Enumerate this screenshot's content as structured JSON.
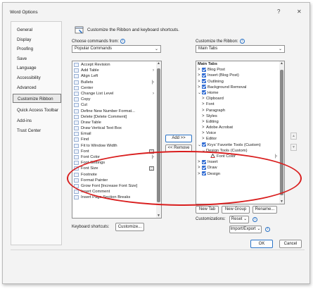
{
  "window": {
    "title": "Word Options",
    "help": "?",
    "close": "✕"
  },
  "nav": {
    "items": [
      "General",
      "Display",
      "Proofing",
      "Save",
      "Language",
      "Accessibility",
      "Advanced",
      "Customize Ribbon",
      "Quick Access Toolbar",
      "Add-ins",
      "Trust Center"
    ],
    "active": "Customize Ribbon"
  },
  "heading": "Customize the Ribbon and keyboard shortcuts.",
  "left": {
    "label": "Choose commands from:",
    "combo": "Popular Commands",
    "commands": [
      {
        "text": "Accept Revision",
        "tail": ""
      },
      {
        "text": "Add Table",
        "tail": "›"
      },
      {
        "text": "Align Left",
        "tail": ""
      },
      {
        "text": "Bullets",
        "tail": "|›"
      },
      {
        "text": "Center",
        "tail": ""
      },
      {
        "text": "Change List Level",
        "tail": "›"
      },
      {
        "text": "Copy",
        "tail": ""
      },
      {
        "text": "Cut",
        "tail": ""
      },
      {
        "text": "Define New Number Format...",
        "tail": ""
      },
      {
        "text": "Delete [Delete Comment]",
        "tail": ""
      },
      {
        "text": "Draw Table",
        "tail": ""
      },
      {
        "text": "Draw Vertical Text Box",
        "tail": ""
      },
      {
        "text": "Email",
        "tail": ""
      },
      {
        "text": "Find",
        "tail": ""
      },
      {
        "text": "Fit to Window Width",
        "tail": ""
      },
      {
        "text": "Font",
        "tail": "▢"
      },
      {
        "text": "Font Color",
        "tail": "|›"
      },
      {
        "text": "Font Settings",
        "tail": ""
      },
      {
        "text": "Font Size",
        "tail": "▢"
      },
      {
        "text": "Footnote",
        "tail": ""
      },
      {
        "text": "Format Painter",
        "tail": ""
      },
      {
        "text": "Grow Font [Increase Font Size]",
        "tail": ""
      },
      {
        "text": "Insert Comment",
        "tail": ""
      },
      {
        "text": "Insert Page Section Breaks",
        "tail": ""
      }
    ],
    "shortcuts_label": "Keyboard shortcuts:",
    "customize_button": "Customize..."
  },
  "mid": {
    "add": "Add >>",
    "remove": "<< Remove"
  },
  "right": {
    "label": "Customize the Ribbon:",
    "combo": "Main Tabs",
    "header": "Main Tabs",
    "tabs": [
      {
        "twisty": ">",
        "check": true,
        "text": "Blog Post",
        "indent": 0
      },
      {
        "twisty": ">",
        "check": true,
        "text": "Insert (Blog Post)",
        "indent": 0
      },
      {
        "twisty": ">",
        "check": true,
        "text": "Outlining",
        "indent": 0
      },
      {
        "twisty": ">",
        "check": true,
        "text": "Background Removal",
        "indent": 0
      },
      {
        "twisty": "⌄",
        "check": true,
        "text": "Home",
        "indent": 0
      },
      {
        "twisty": ">",
        "check": false,
        "text": "Clipboard",
        "indent": 1
      },
      {
        "twisty": ">",
        "check": false,
        "text": "Font",
        "indent": 1
      },
      {
        "twisty": ">",
        "check": false,
        "text": "Paragraph",
        "indent": 1
      },
      {
        "twisty": ">",
        "check": false,
        "text": "Styles",
        "indent": 1
      },
      {
        "twisty": ">",
        "check": false,
        "text": "Editing",
        "indent": 1
      },
      {
        "twisty": ">",
        "check": false,
        "text": "Adobe Acrobat",
        "indent": 1
      },
      {
        "twisty": ">",
        "check": false,
        "text": "Voice",
        "indent": 1
      },
      {
        "twisty": ">",
        "check": false,
        "text": "Editor",
        "indent": 1
      },
      {
        "twisty": "⌄",
        "check": true,
        "text": "Krys' Favorite Tools (Custom)",
        "indent": 0
      },
      {
        "twisty": "⌄",
        "check": false,
        "text": "Design Tools (Custom)",
        "indent": 1
      },
      {
        "twisty": "",
        "check": false,
        "text": "Font Color",
        "indent": 2
      },
      {
        "twisty": ">",
        "check": true,
        "text": "Insert",
        "indent": 0
      },
      {
        "twisty": ">",
        "check": true,
        "text": "Draw",
        "indent": 0
      },
      {
        "twisty": ">",
        "check": true,
        "text": "Design",
        "indent": 0
      }
    ],
    "new_tab": "New Tab",
    "new_group": "New Group",
    "rename": "Rename...",
    "customizations_label": "Customizations:",
    "reset": "Reset",
    "import_export": "Import/Export"
  },
  "footer": {
    "ok": "OK",
    "cancel": "Cancel"
  },
  "colors": {
    "accent": "#2a73c7",
    "highlight": "#d91e1e",
    "checkbox": "#2f6bd3"
  }
}
